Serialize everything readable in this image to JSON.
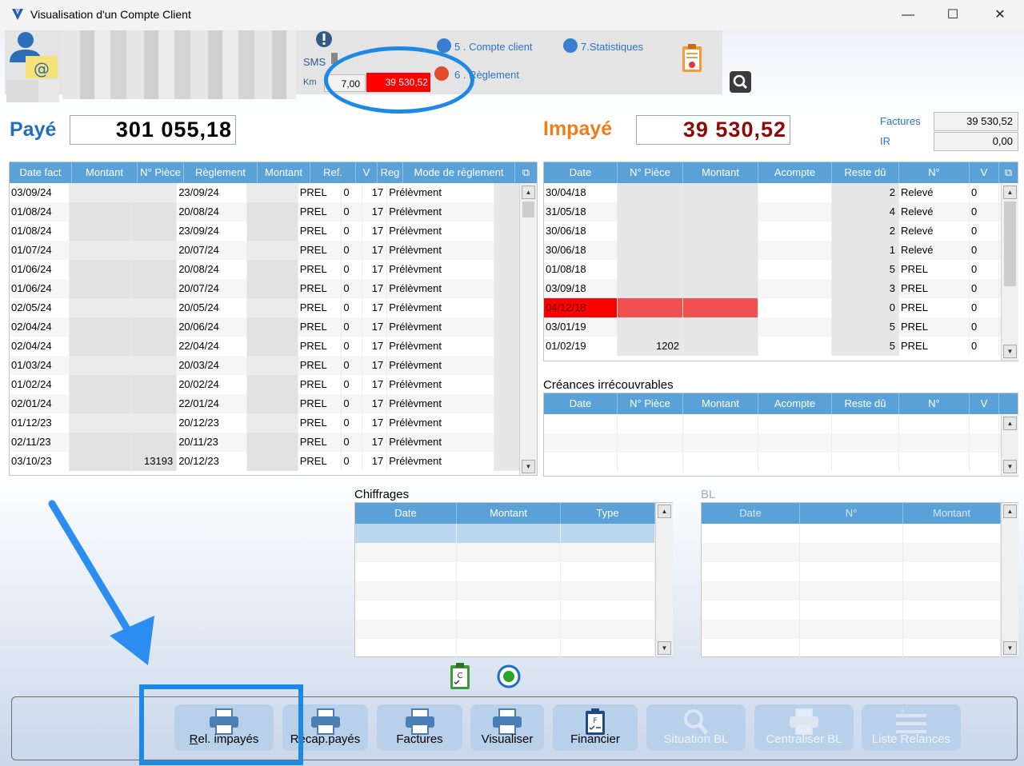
{
  "window": {
    "title": "Visualisation d'un Compte Client",
    "min": "—",
    "max": "☐",
    "close": "✕"
  },
  "header": {
    "sms_label": "SMS",
    "km_label": "Km",
    "km_value": "7,00",
    "impaye_value": "39 530,52",
    "links": [
      {
        "label": "5 . Compte client",
        "color": "#3a7fcf"
      },
      {
        "label": "7.Statistiques",
        "color": "#3a7fcf"
      },
      {
        "label": "6 . Règlement",
        "color": "#e34a2c"
      }
    ]
  },
  "totals": {
    "paye_label": "Payé",
    "paye_value": "301 055,18",
    "impaye_label": "Impayé",
    "impaye_value": "39 530,52",
    "factures_label": "Factures",
    "factures_value": "39 530,52",
    "ir_label": "IR",
    "ir_value": "0,00"
  },
  "payments": {
    "columns": [
      "Date fact",
      "Montant",
      "N° Pièce",
      "Règlement",
      "Montant",
      "Ref.",
      "V",
      "Reg",
      "Mode de règlement"
    ],
    "rows": [
      [
        "03/09/24",
        "",
        "",
        "23/09/24",
        "",
        "PREL",
        "0",
        "17",
        "Prélèvment"
      ],
      [
        "01/08/24",
        "",
        "",
        "20/08/24",
        "",
        "PREL",
        "0",
        "17",
        "Prélèvment"
      ],
      [
        "01/08/24",
        "",
        "",
        "23/09/24",
        "",
        "PREL",
        "0",
        "17",
        "Prélèvment"
      ],
      [
        "01/07/24",
        "",
        "",
        "20/07/24",
        "",
        "PREL",
        "0",
        "17",
        "Prélèvment"
      ],
      [
        "01/06/24",
        "",
        "",
        "20/08/24",
        "",
        "PREL",
        "0",
        "17",
        "Prélèvment"
      ],
      [
        "01/06/24",
        "",
        "",
        "20/07/24",
        "",
        "PREL",
        "0",
        "17",
        "Prélèvment"
      ],
      [
        "02/05/24",
        "",
        "",
        "20/05/24",
        "",
        "PREL",
        "0",
        "17",
        "Prélèvment"
      ],
      [
        "02/04/24",
        "",
        "",
        "20/06/24",
        "",
        "PREL",
        "0",
        "17",
        "Prélèvment"
      ],
      [
        "02/04/24",
        "",
        "",
        "22/04/24",
        "",
        "PREL",
        "0",
        "17",
        "Prélèvment"
      ],
      [
        "01/03/24",
        "",
        "",
        "20/03/24",
        "",
        "PREL",
        "0",
        "17",
        "Prélèvment"
      ],
      [
        "01/02/24",
        "",
        "",
        "20/02/24",
        "",
        "PREL",
        "0",
        "17",
        "Prélèvment"
      ],
      [
        "02/01/24",
        "",
        "",
        "22/01/24",
        "",
        "PREL",
        "0",
        "17",
        "Prélèvment"
      ],
      [
        "01/12/23",
        "",
        "",
        "20/12/23",
        "",
        "PREL",
        "0",
        "17",
        "Prélèvment"
      ],
      [
        "02/11/23",
        "",
        "",
        "20/11/23",
        "",
        "PREL",
        "0",
        "17",
        "Prélèvment"
      ],
      [
        "03/10/23",
        "",
        "13193",
        "20/12/23",
        "",
        "PREL",
        "0",
        "17",
        "Prélèvment"
      ]
    ]
  },
  "unpaid": {
    "columns": [
      "Date",
      "N° Pièce",
      "Montant",
      "Acompte",
      "Reste dû",
      "N°",
      "V"
    ],
    "rows": [
      [
        "30/04/18",
        "",
        "",
        "",
        "2",
        "Relevé",
        "0"
      ],
      [
        "31/05/18",
        "",
        "",
        "",
        "4",
        "Relevé",
        "0"
      ],
      [
        "30/06/18",
        "",
        "",
        "",
        "2",
        "Relevé",
        "0"
      ],
      [
        "30/06/18",
        "",
        "",
        "",
        "1",
        "Relevé",
        "0"
      ],
      [
        "01/08/18",
        "",
        "",
        "",
        "5",
        "PREL",
        "0"
      ],
      [
        "03/09/18",
        "",
        "",
        "",
        "3",
        "PREL",
        "0"
      ],
      [
        "04/12/18",
        "",
        "",
        "",
        "0",
        "PREL",
        "0"
      ],
      [
        "03/01/19",
        "",
        "",
        "",
        "5",
        "PREL",
        "0"
      ],
      [
        "01/02/19",
        "1202",
        "",
        "",
        "5",
        "PREL",
        "0"
      ]
    ],
    "highlight_row": 6
  },
  "creances": {
    "title": "Créances irrécouvrables",
    "columns": [
      "Date",
      "N° Pièce",
      "Montant",
      "Acompte",
      "Reste dû",
      "N°",
      "V"
    ]
  },
  "chiffrages": {
    "title": "Chiffrages",
    "columns": [
      "Date",
      "Montant",
      "Type"
    ]
  },
  "bl": {
    "title": "BL",
    "columns": [
      "Date",
      "N°",
      "Montant"
    ]
  },
  "toolbar": {
    "buttons": [
      {
        "label": "Rel. impayés",
        "enabled": true
      },
      {
        "label": "Récap.payés",
        "enabled": true
      },
      {
        "label": "Factures",
        "enabled": true
      },
      {
        "label": "Visualiser",
        "enabled": true
      },
      {
        "label": "Financier",
        "enabled": true
      },
      {
        "label": "Situation BL",
        "enabled": false
      },
      {
        "label": "Centraliser BL",
        "enabled": false
      },
      {
        "label": "Liste Relances",
        "enabled": false
      }
    ]
  },
  "colors": {
    "header_blue": "#5aa1d8",
    "impaye_red": "#ff0000",
    "paye_blue": "#1f6fbf",
    "impaye_orange": "#f07d1a",
    "impaye_value_color": "#8b0a0a"
  }
}
